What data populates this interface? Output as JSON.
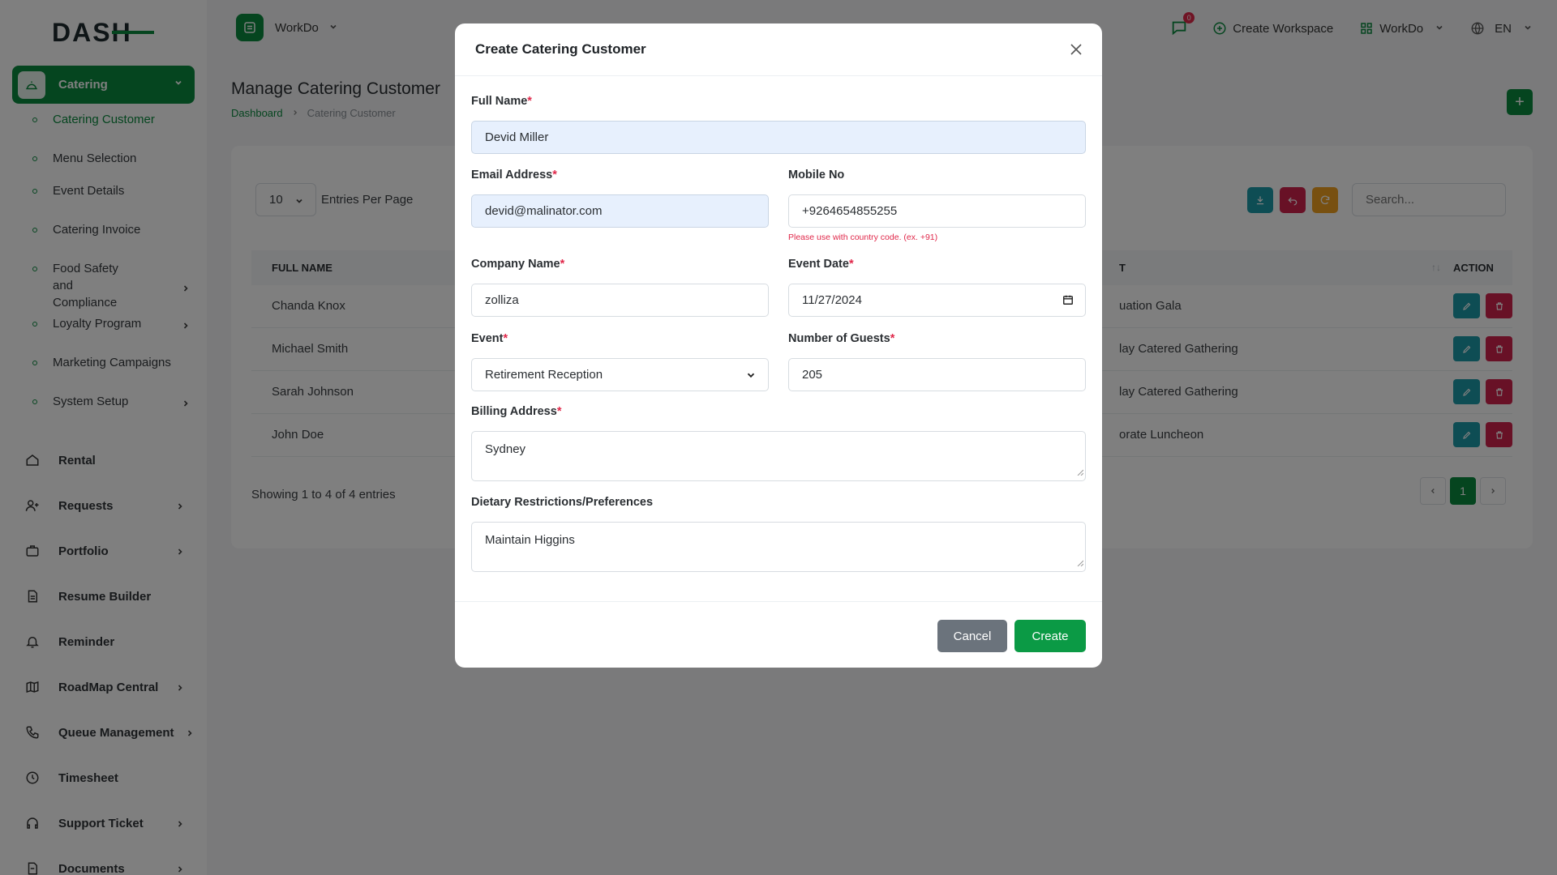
{
  "brand": {
    "logo_text": "DASH"
  },
  "sidebar": {
    "active_module": "Catering",
    "sub_items": [
      {
        "label": "Catering Customer",
        "active": true
      },
      {
        "label": "Menu Selection"
      },
      {
        "label": "Event Details"
      },
      {
        "label": "Catering Invoice"
      },
      {
        "label": "Food Safety and Compliance",
        "has_children": true
      },
      {
        "label": "Loyalty Program",
        "has_children": true
      },
      {
        "label": "Marketing Campaigns"
      },
      {
        "label": "System Setup",
        "has_children": true
      }
    ],
    "items": [
      {
        "label": "Rental",
        "icon": "home-icon"
      },
      {
        "label": "Requests",
        "icon": "user-plus-icon",
        "has_children": true
      },
      {
        "label": "Portfolio",
        "icon": "briefcase-icon",
        "has_children": true
      },
      {
        "label": "Resume Builder",
        "icon": "document-icon"
      },
      {
        "label": "Reminder",
        "icon": "bell-icon"
      },
      {
        "label": "RoadMap Central",
        "icon": "map-icon",
        "has_children": true
      },
      {
        "label": "Queue Management",
        "icon": "phone-icon",
        "has_children": true
      },
      {
        "label": "Timesheet",
        "icon": "clock-icon"
      },
      {
        "label": "Support Ticket",
        "icon": "headphones-icon",
        "has_children": true
      },
      {
        "label": "Documents",
        "icon": "file-icon",
        "has_children": true
      }
    ]
  },
  "topbar": {
    "workspace": "WorkDo",
    "notifications": "0",
    "create_workspace": "Create Workspace",
    "workspace_switch": "WorkDo",
    "language": "EN"
  },
  "page": {
    "title": "Manage Catering Customer",
    "breadcrumb": [
      "Dashboard",
      "Catering Customer"
    ],
    "entries_value": "10",
    "entries_label": "Entries Per Page",
    "search_placeholder": "Search...",
    "columns": {
      "name": "FULL NAME",
      "event": "T",
      "action": "ACTION"
    },
    "rows": [
      {
        "name": "Chanda Knox",
        "event": "uation Gala"
      },
      {
        "name": "Michael Smith",
        "event": "lay Catered Gathering"
      },
      {
        "name": "Sarah Johnson",
        "event": "lay Catered Gathering"
      },
      {
        "name": "John Doe",
        "event": "orate Luncheon"
      }
    ],
    "showing": "Showing 1 to 4 of 4 entries",
    "current_page": "1"
  },
  "modal": {
    "title": "Create Catering Customer",
    "full_name": {
      "label": "Full Name",
      "value": "Devid Miller"
    },
    "email": {
      "label": "Email Address",
      "value": "devid@malinator.com"
    },
    "mobile": {
      "label": "Mobile No",
      "value": "+9264654855255",
      "help": "Please use with country code. (ex. +91)"
    },
    "company": {
      "label": "Company Name",
      "value": "zolliza"
    },
    "event_date": {
      "label": "Event Date",
      "value": "11/27/2024"
    },
    "event": {
      "label": "Event",
      "value": "Retirement Reception"
    },
    "guests": {
      "label": "Number of Guests",
      "value": "205"
    },
    "billing": {
      "label": "Billing Address",
      "value": "Sydney"
    },
    "dietary": {
      "label": "Dietary Restrictions/Preferences",
      "value": "Maintain Higgins"
    },
    "cancel": "Cancel",
    "create": "Create"
  },
  "colors": {
    "primary": "#0b8a3f",
    "danger": "#d1234d",
    "info": "#1c9aa8",
    "warning": "#f0a020"
  }
}
